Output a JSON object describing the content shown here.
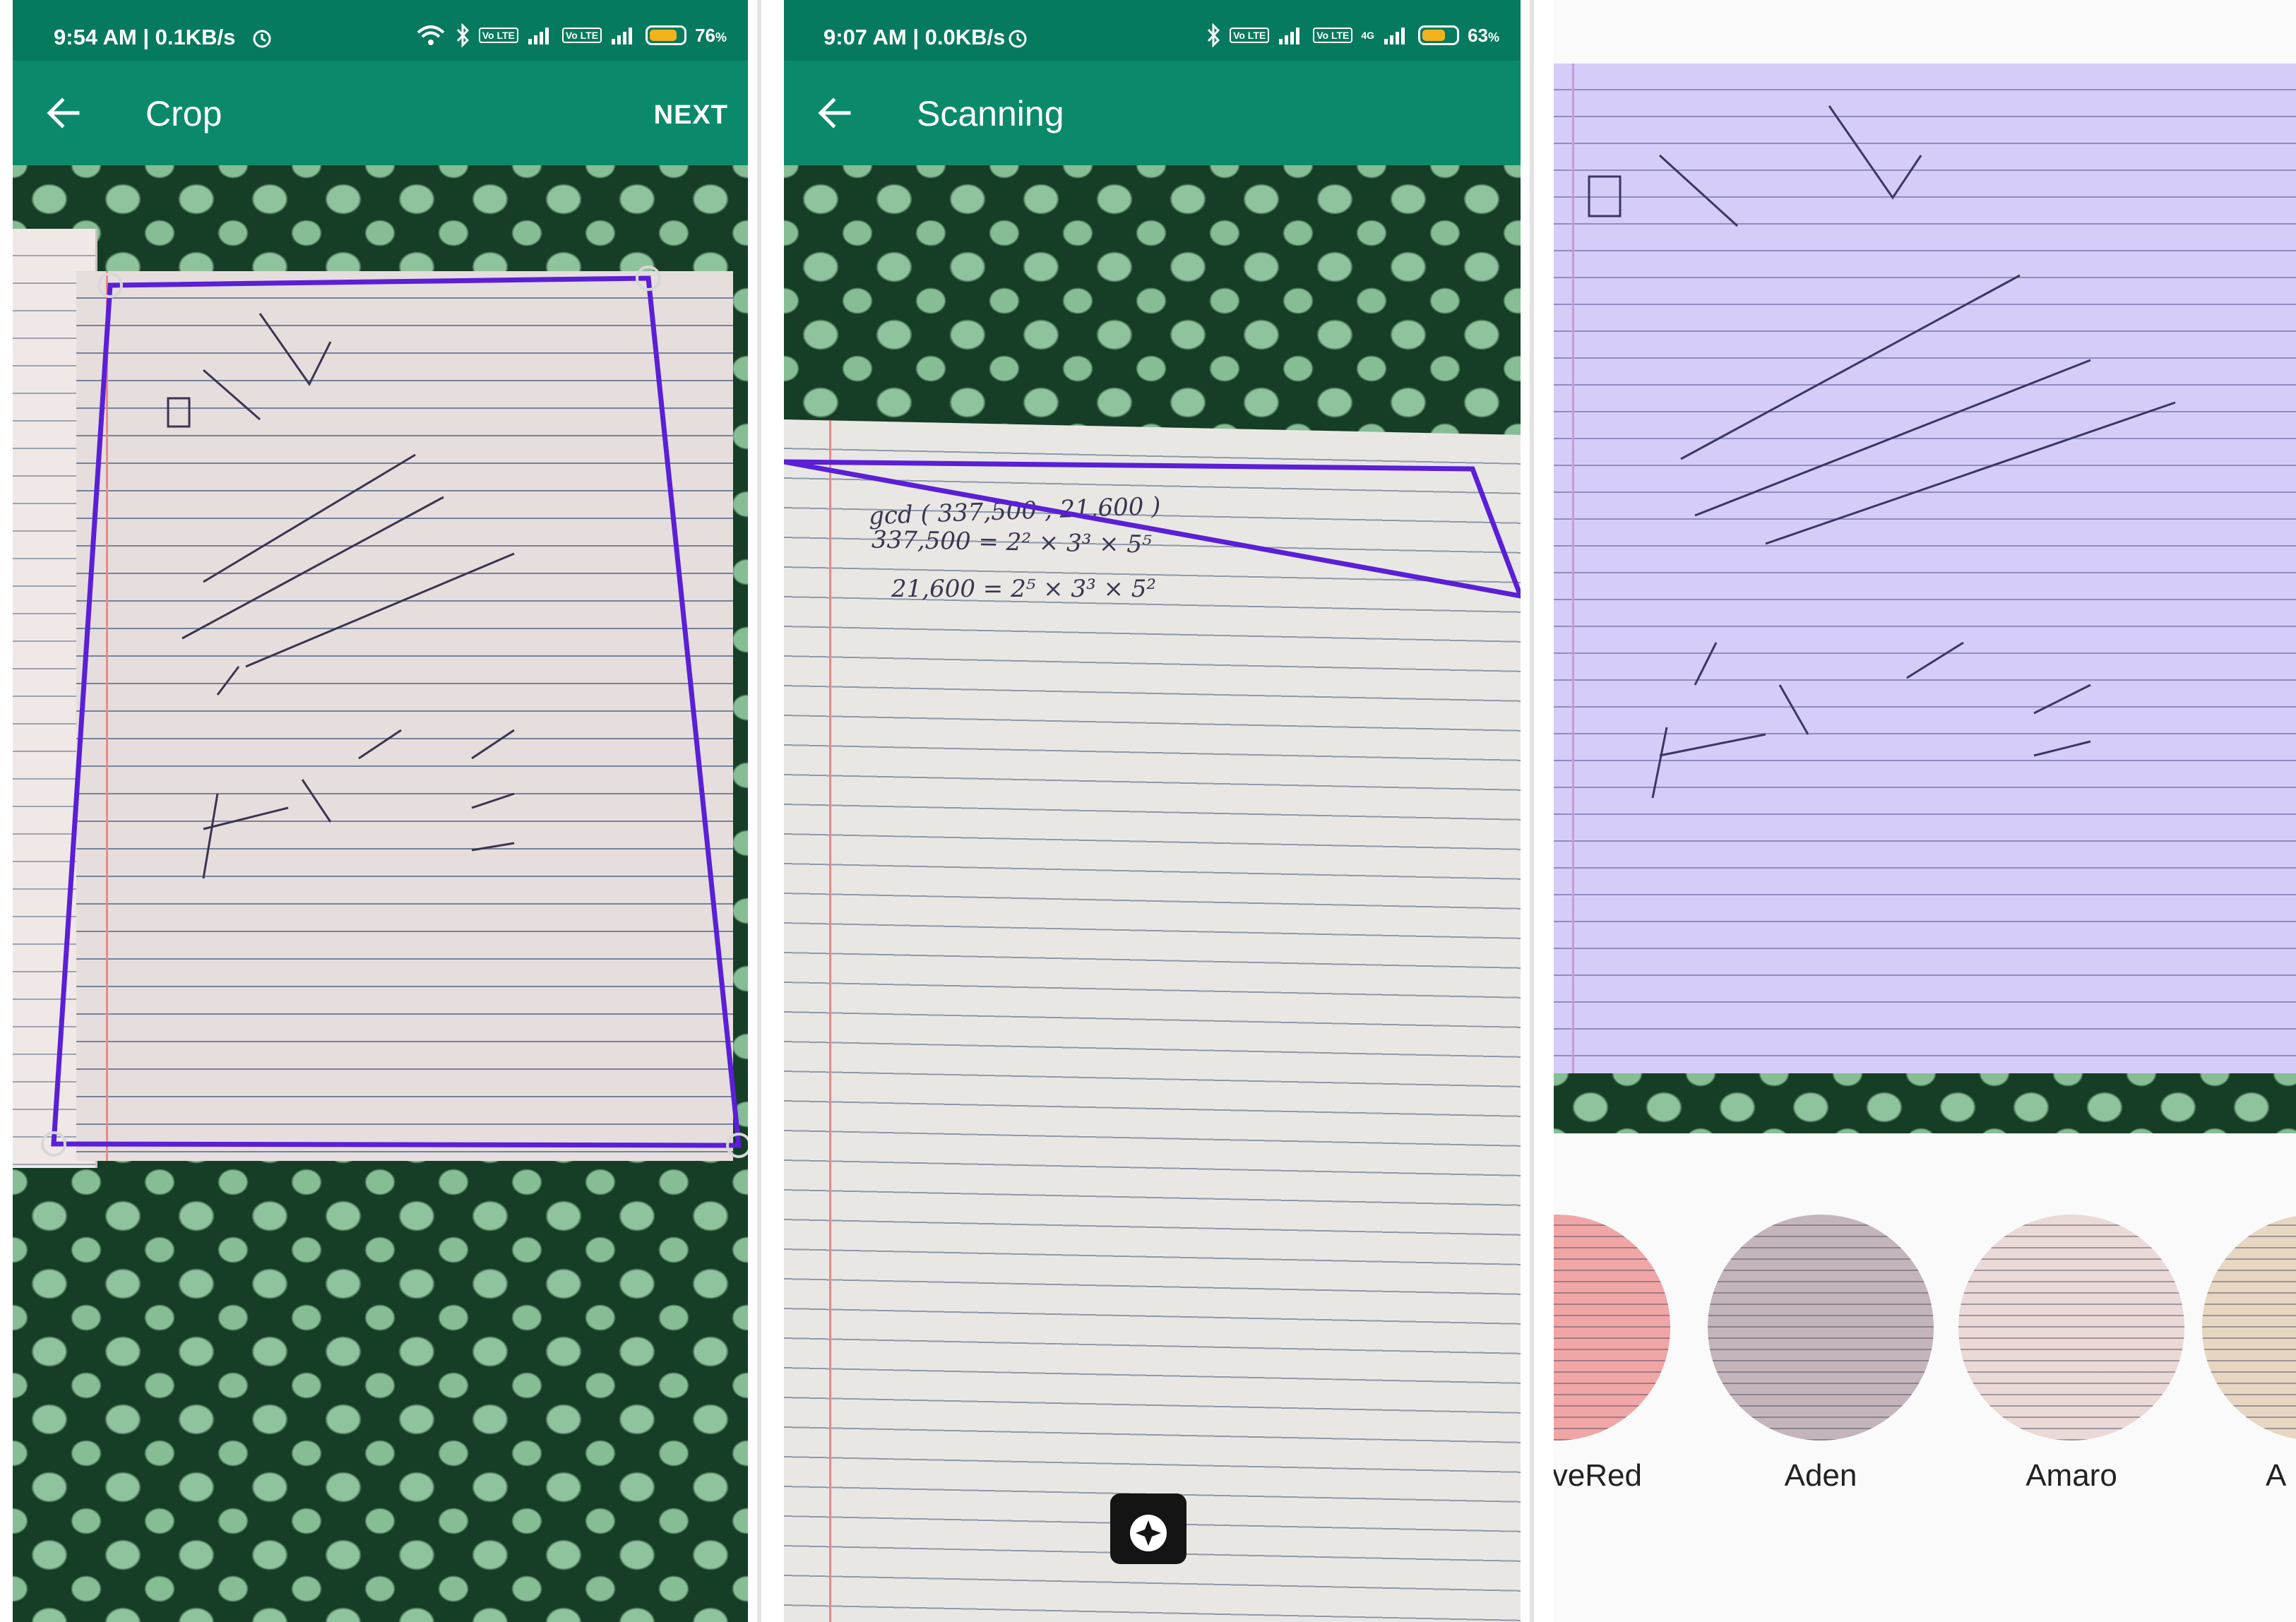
{
  "screens": [
    {
      "status_time": "9:54 AM | 0.1KB/s",
      "battery": "76",
      "battery_unit": "%",
      "title": "Crop",
      "action": "NEXT"
    },
    {
      "status_time": "9:07 AM | 0.0KB/s",
      "battery": "63",
      "battery_unit": "%",
      "title": "Scanning"
    },
    {
      "filters": [
        "ctiveRed",
        "Aden",
        "Amaro",
        "A"
      ]
    }
  ],
  "network_label": "4G",
  "volte_label": "Vo LTE",
  "colors": {
    "statusbar": "#067a5e",
    "appbar": "#0b8a6b",
    "crop_outline": "#5a1fd6",
    "battery_fill": "#f2b21a"
  },
  "icons": {
    "back": "arrow-left-icon",
    "alarm": "alarm-clock-icon",
    "wifi": "wifi-icon",
    "bluetooth": "bluetooth-icon",
    "camera": "camera-icon"
  },
  "scan_notes": {
    "line1": "gcd ( 337,500 , 21,600 )",
    "line2": "337,500 = 2² × 3³ × 5⁵",
    "line3": "21,600 = 2⁵ × 3³ × 5²"
  }
}
